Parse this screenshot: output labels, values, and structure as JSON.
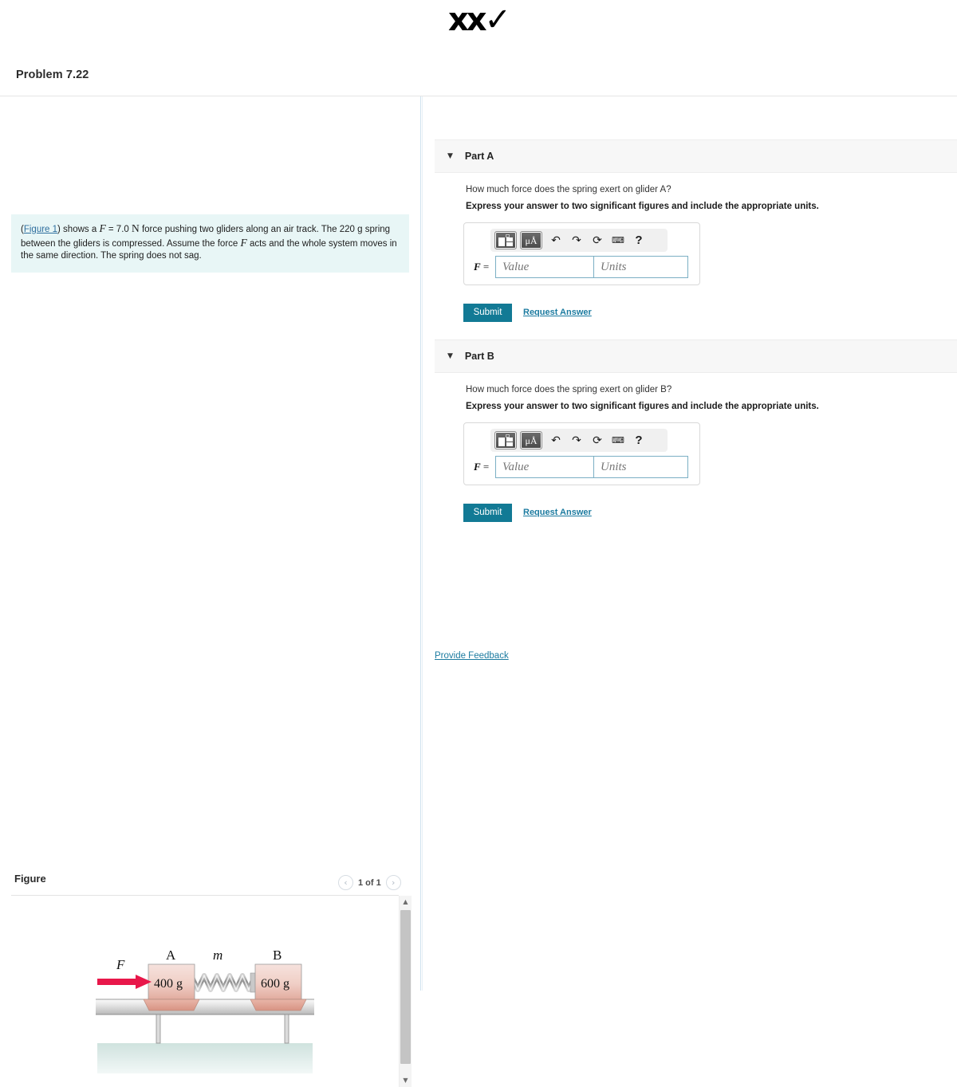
{
  "grade_mark": "xx✓",
  "problem": {
    "title": "Problem 7.22",
    "statement_link": "Figure 1",
    "statement_pre": ") shows a ",
    "force_symbol": "F",
    "force_value": " = 7.0 ",
    "force_unit": "N",
    "statement_mid": " force pushing two gliders along an air track. The 220 g spring between the gliders is compressed. Assume the force ",
    "force_symbol2": "F",
    "statement_post": " acts and the whole system moves in the same direction. The spring does not sag."
  },
  "figure": {
    "header": "Figure",
    "counter": "1 of 1",
    "prev_icon": "chevron-left-icon",
    "next_icon": "chevron-right-icon",
    "diagram": {
      "force_label": "F",
      "glider_a_label": "A",
      "glider_a_mass": "400 g",
      "spring_label": "m",
      "glider_b_label": "B",
      "glider_b_mass": "600 g"
    },
    "scrollbar": {
      "up_icon": "▲",
      "down_icon": "▼"
    }
  },
  "toolbar_icons": {
    "template": "math-template-icon",
    "units": "μÅ",
    "undo": "↶",
    "redo": "↷",
    "reset": "⟳",
    "keyboard": "⌨",
    "help": "?"
  },
  "parts": [
    {
      "caret": "▼",
      "label": "Part A",
      "question": "How much force does the spring exert on glider A?",
      "instruction": "Express your answer to two significant figures and include the appropriate units.",
      "field_label": "F",
      "field_equals": "=",
      "value_placeholder": "Value",
      "units_placeholder": "Units",
      "value_current": "",
      "units_current": "",
      "submit_label": "Submit",
      "request_answer_label": "Request Answer"
    },
    {
      "caret": "▼",
      "label": "Part B",
      "question": "How much force does the spring exert on glider B?",
      "instruction": "Express your answer to two significant figures and include the appropriate units.",
      "field_label": "F",
      "field_equals": "=",
      "value_placeholder": "Value",
      "units_placeholder": "Units",
      "value_current": "",
      "units_current": "",
      "submit_label": "Submit",
      "request_answer_label": "Request Answer"
    }
  ],
  "provide_feedback_label": "Provide Feedback",
  "colors": {
    "accent_teal": "#127a95",
    "link_blue": "#1c7ba0",
    "statement_bg": "#e8f6f6",
    "part_header_bg": "#f7f7f7",
    "input_border": "#7bafc4",
    "force_arrow": "#e8174a"
  }
}
